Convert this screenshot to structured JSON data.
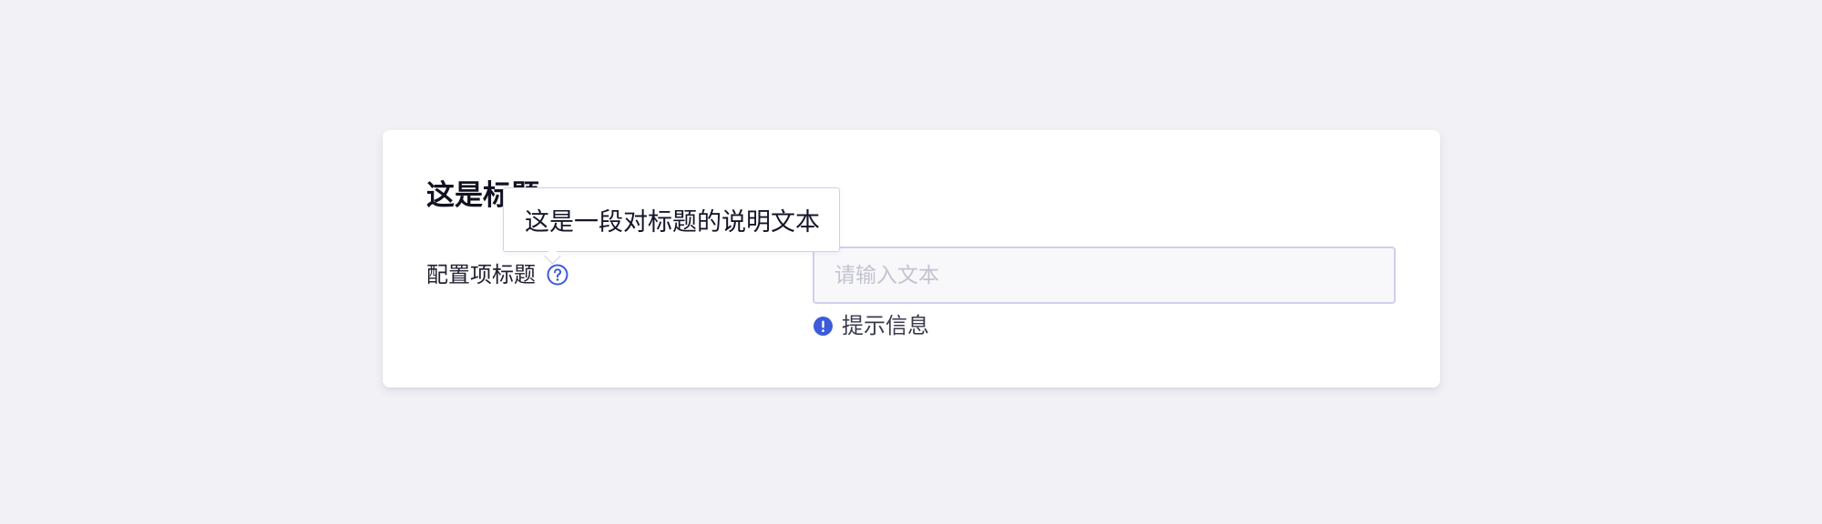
{
  "card": {
    "title": "这是标题"
  },
  "field": {
    "label": "配置项标题",
    "help_icon": "question-circle-icon",
    "input_placeholder": "请输入文本",
    "input_value": "",
    "hint_icon": "exclamation-circle-icon",
    "hint_text": "提示信息"
  },
  "tooltip": {
    "text": "这是一段对标题的说明文本"
  },
  "colors": {
    "accent": "#3b5bdb",
    "background": "#f2f2f6",
    "card": "#ffffff",
    "input_border": "#cfd0ec",
    "placeholder": "#c2c3cf"
  }
}
